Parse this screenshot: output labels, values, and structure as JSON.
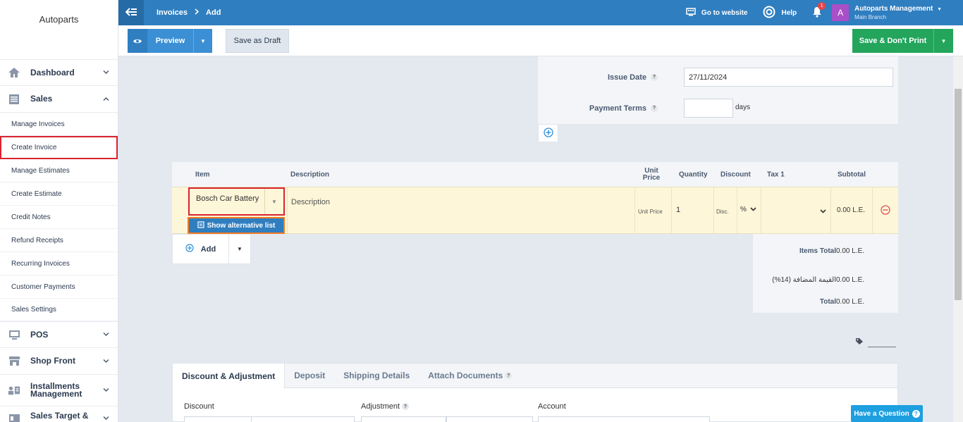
{
  "sidebar": {
    "brand": "Autoparts",
    "main_items": [
      {
        "label": "Dashboard"
      },
      {
        "label": "Sales"
      },
      {
        "label": "POS"
      },
      {
        "label": "Shop Front"
      },
      {
        "label": "Installments Management"
      },
      {
        "label": "Sales Target &"
      }
    ],
    "sales_sub": [
      "Manage Invoices",
      "Create Invoice",
      "Manage Estimates",
      "Create Estimate",
      "Credit Notes",
      "Refund Receipts",
      "Recurring Invoices",
      "Customer Payments",
      "Sales Settings"
    ],
    "active_sub": "Create Invoice"
  },
  "topbar": {
    "breadcrumb": [
      "Invoices",
      "Add"
    ],
    "go_to_website": "Go to website",
    "help": "Help",
    "notification_count": "1",
    "account_initial": "A",
    "account_name": "Autoparts Management",
    "account_branch": "Main Branch"
  },
  "actions": {
    "preview": "Preview",
    "save_draft": "Save as Draft",
    "save_no_print": "Save & Don't Print"
  },
  "form": {
    "issue_date_label": "Issue Date",
    "issue_date_value": "27/11/2024",
    "payment_terms_label": "Payment Terms",
    "payment_terms_value": "",
    "days_label": "days"
  },
  "items_table": {
    "headers": {
      "item": "Item",
      "description": "Description",
      "unit_price": "Unit Price",
      "quantity": "Quantity",
      "discount": "Discount",
      "tax1": "Tax 1",
      "subtotal": "Subtotal"
    },
    "row": {
      "item": "Bosch Car Battery",
      "alt_list": "Show alternative list",
      "description_placeholder": "Description",
      "unit_price_placeholder": "Unit Price",
      "quantity": "1",
      "discount_placeholder": "Disc.",
      "discount_type": "%",
      "tax": "",
      "subtotal": "0.00 L.E."
    },
    "add_label": "Add"
  },
  "totals": {
    "items_total_label": "Items Total",
    "items_total_value": "0.00 L.E.",
    "vat_label": "القيمة المضافة (14%)",
    "vat_value": "0.00 L.E.",
    "total_label": "Total",
    "total_value": "0.00 L.E."
  },
  "tabs": {
    "items": [
      "Discount & Adjustment",
      "Deposit",
      "Shipping Details",
      "Attach Documents"
    ],
    "active": "Discount & Adjustment",
    "discount_label": "Discount",
    "adjustment_label": "Adjustment",
    "account_label": "Account"
  },
  "help_button": "Have a Question",
  "colors": {
    "topbar": "#2f7ec0",
    "save_green": "#23a55c",
    "active_outline": "#d9232e",
    "alt_outline": "#f27a22",
    "row_yellow": "#fdf6d8"
  }
}
